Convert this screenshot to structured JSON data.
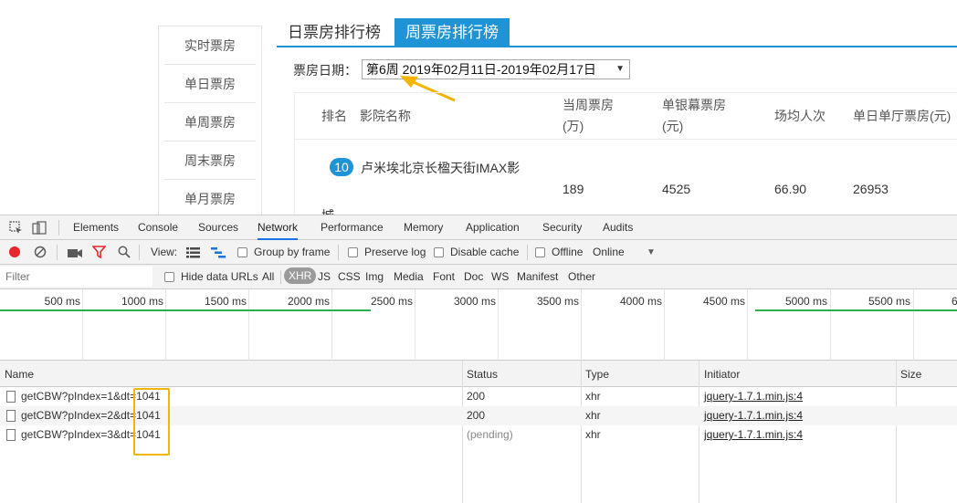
{
  "page": {
    "left_nav": [
      "实时票房",
      "单日票房",
      "单周票房",
      "周末票房",
      "单月票房"
    ],
    "tabs": {
      "inactive": "日票房排行榜",
      "active": "周票房排行榜"
    },
    "date_label": "票房日期：",
    "date_select_value": "第6周 2019年02月11日-2019年02月17日",
    "table": {
      "headers": [
        "排名",
        "影院名称",
        "当周票房",
        "(万)",
        "单银幕票房",
        "(元)",
        "场均人次",
        "单日单厅票房(元)"
      ],
      "row": {
        "rank": "10",
        "cinema": "卢米埃北京长楹天街IMAX影",
        "cinema_wrap": "城",
        "weekly_box": "189",
        "per_screen": "4525",
        "avg_attendance": "66.90",
        "per_hall_daily": "26953"
      }
    }
  },
  "devtools": {
    "tabs": [
      "Elements",
      "Console",
      "Sources",
      "Network",
      "Performance",
      "Memory",
      "Application",
      "Security",
      "Audits"
    ],
    "active_tab": "Network",
    "toolbar": {
      "view_label": "View:",
      "group_by_frame": "Group by frame",
      "preserve_log": "Preserve log",
      "disable_cache": "Disable cache",
      "offline": "Offline",
      "throttle": "Online"
    },
    "filter": {
      "placeholder": "Filter",
      "hide_data_urls": "Hide data URLs",
      "types": [
        "All",
        "XHR",
        "JS",
        "CSS",
        "Img",
        "Media",
        "Font",
        "Doc",
        "WS",
        "Manifest",
        "Other"
      ],
      "active_type": "XHR"
    },
    "timeline_ticks": [
      "500 ms",
      "1000 ms",
      "1500 ms",
      "2000 ms",
      "2500 ms",
      "3000 ms",
      "3500 ms",
      "4000 ms",
      "4500 ms",
      "5000 ms",
      "5500 ms",
      "6"
    ],
    "columns": [
      "Name",
      "Status",
      "Type",
      "Initiator",
      "Size"
    ],
    "requests": [
      {
        "name": "getCBW?pIndex=1&dt=1041",
        "status": "200",
        "type": "xhr",
        "initiator": "jquery-1.7.1.min.js:4"
      },
      {
        "name": "getCBW?pIndex=2&dt=1041",
        "status": "200",
        "type": "xhr",
        "initiator": "jquery-1.7.1.min.js:4"
      },
      {
        "name": "getCBW?pIndex=3&dt=1041",
        "status": "(pending)",
        "type": "xhr",
        "initiator": "jquery-1.7.1.min.js:4"
      }
    ]
  },
  "colors": {
    "accent_blue": "#1e94d6",
    "annotation_orange": "#f5b400",
    "devtools_active": "#1a73e8"
  }
}
